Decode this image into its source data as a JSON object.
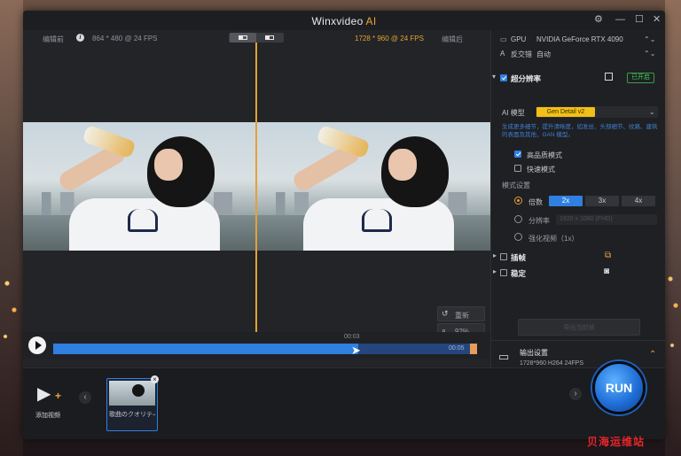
{
  "app": {
    "title_main": "Winxvideo",
    "title_ai": "AI"
  },
  "window_controls": {
    "settings": "⚙",
    "minimize": "—",
    "maximize": "☐",
    "close": "✕"
  },
  "preview": {
    "before_label": "编辑前",
    "before_res": "864 * 480 @ 24 FPS",
    "after_res": "1728 * 960 @ 24 FPS",
    "after_label": "编辑后",
    "info": "i",
    "reset_label": "重新",
    "zoom_label": "92%"
  },
  "timeline": {
    "current": "00:03",
    "end": "00:05",
    "progress": 0.72
  },
  "settings": {
    "gpu_label": "GPU",
    "gpu_value": "NVIDIA GeForce RTX 4090",
    "deinterlace_label": "反交错",
    "deinterlace_value": "自动",
    "superres_title": "超分辨率",
    "superres_status": "已开启",
    "ai_model_label": "AI 模型",
    "ai_model_value": "Gen Detail v2",
    "description": "生成更多细节，提升清晰度，如发丝、头部细节、纹路、建筑的表面及其他，GAN 模型。",
    "hq_mode": "高品质模式",
    "fast_mode": "快速模式",
    "mode_settings": "模式设置",
    "scale_label": "倍数",
    "scale_options": [
      "2x",
      "3x",
      "4x"
    ],
    "resolution_label": "分辨率",
    "resolution_value": "1920 x 1080 (FHD)",
    "enhance_label": "强化视频（1x）",
    "frame_interp_title": "插帧",
    "stabilize_title": "稳定",
    "export_label": "导出当前帧"
  },
  "output": {
    "title": "输出设置",
    "details": "1728*960  H264  24FPS"
  },
  "bottom": {
    "add_video_label": "添加视频",
    "clip_name": "歌曲のクオリティ",
    "close": "×",
    "prev": "‹",
    "next": "›",
    "run_label": "RUN"
  },
  "watermark": "贝海运维站",
  "colors": {
    "accent": "#2f80e0",
    "divider": "#e3a233",
    "ai_orange": "#f2a33a",
    "enabled_green": "#3fd15f"
  }
}
